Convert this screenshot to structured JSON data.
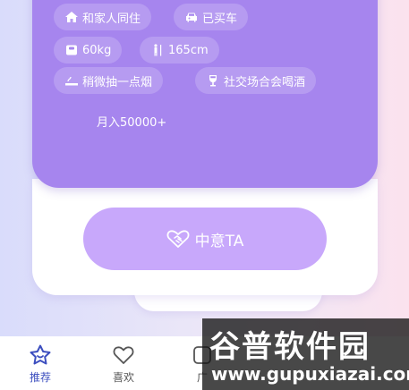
{
  "profile": {
    "tags": [
      {
        "icon": "house-icon",
        "label": "和家人同住"
      },
      {
        "icon": "car-icon",
        "label": "已买车"
      },
      {
        "icon": "scale-icon",
        "label": "60kg"
      },
      {
        "icon": "person-height-icon",
        "label": "165cm"
      },
      {
        "icon": "cigarette-icon",
        "label": "稍微抽一点烟"
      },
      {
        "icon": "wine-glass-icon",
        "label": "社交场合会喝酒"
      }
    ],
    "income": "月入50000+"
  },
  "action": {
    "like_label": "中意TA"
  },
  "tabbar": {
    "items": [
      {
        "icon": "star-face-icon",
        "label": "推荐"
      },
      {
        "icon": "heart-icon",
        "label": "喜欢"
      },
      {
        "icon": "square-icon",
        "label": "广"
      }
    ]
  },
  "watermark": {
    "title": "谷普软件园",
    "url": "www.gupuxiazai.com"
  },
  "colors": {
    "card": "#a685ee",
    "button": "#c8a8fb",
    "active_tab": "#3d4fbf"
  }
}
